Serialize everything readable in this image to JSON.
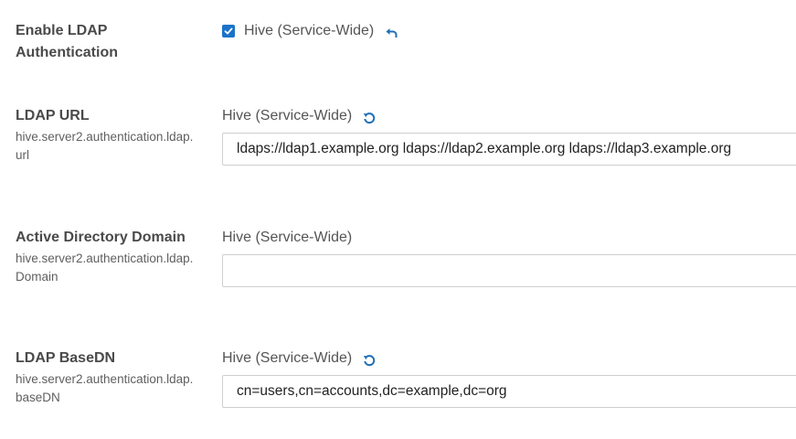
{
  "ldap_auth": {
    "title_line1": "Enable LDAP",
    "title_line2": "Authentication",
    "scope": "Hive (Service-Wide)",
    "checked": true
  },
  "ldap_url": {
    "title": "LDAP URL",
    "property_line1": "hive.server2.authentication.ldap.",
    "property_line2": "url",
    "scope": "Hive (Service-Wide)",
    "value": "ldaps://ldap1.example.org ldaps://ldap2.example.org ldaps://ldap3.example.org"
  },
  "ad_domain": {
    "title": "Active Directory Domain",
    "property_line1": "hive.server2.authentication.ldap.",
    "property_line2": "Domain",
    "scope": "Hive (Service-Wide)",
    "value": ""
  },
  "ldap_basedn": {
    "title": "LDAP BaseDN",
    "property_line1": "hive.server2.authentication.ldap.",
    "property_line2": "baseDN",
    "scope": "Hive (Service-Wide)",
    "value": "cn=users,cn=accounts,dc=example,dc=org"
  },
  "colors": {
    "accent": "#1a73c9",
    "icon": "#1f6fb5"
  }
}
